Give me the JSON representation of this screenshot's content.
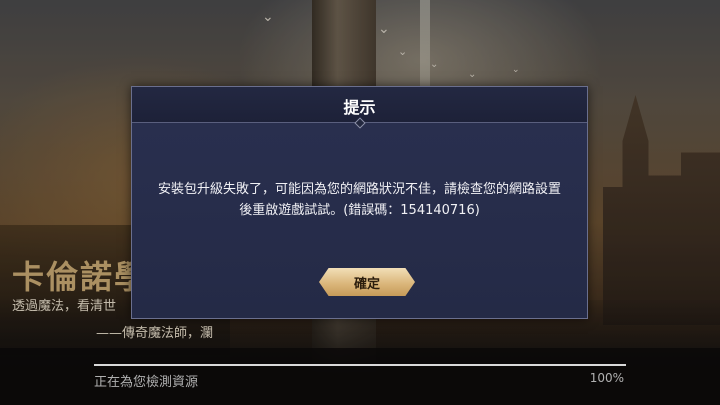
{
  "background": {
    "title": "卡倫諾學",
    "subtitle": "透過魔法，看清世",
    "signature": "——傳奇魔法師，瀾"
  },
  "loading": {
    "label": "正在為您檢測資源",
    "percent_text": "100%",
    "progress": 1.0
  },
  "dialog": {
    "title": "提示",
    "message": "安裝包升級失敗了，可能因為您的網路狀況不佳，請檢查您的網路設置後重啟遊戲試試。(錯誤碼：154140716)",
    "confirm_label": "確定"
  },
  "colors": {
    "dialog_bg": "#262c48",
    "button_gold": "#dbb77c",
    "bg_title_gold": "#c9aa74"
  }
}
